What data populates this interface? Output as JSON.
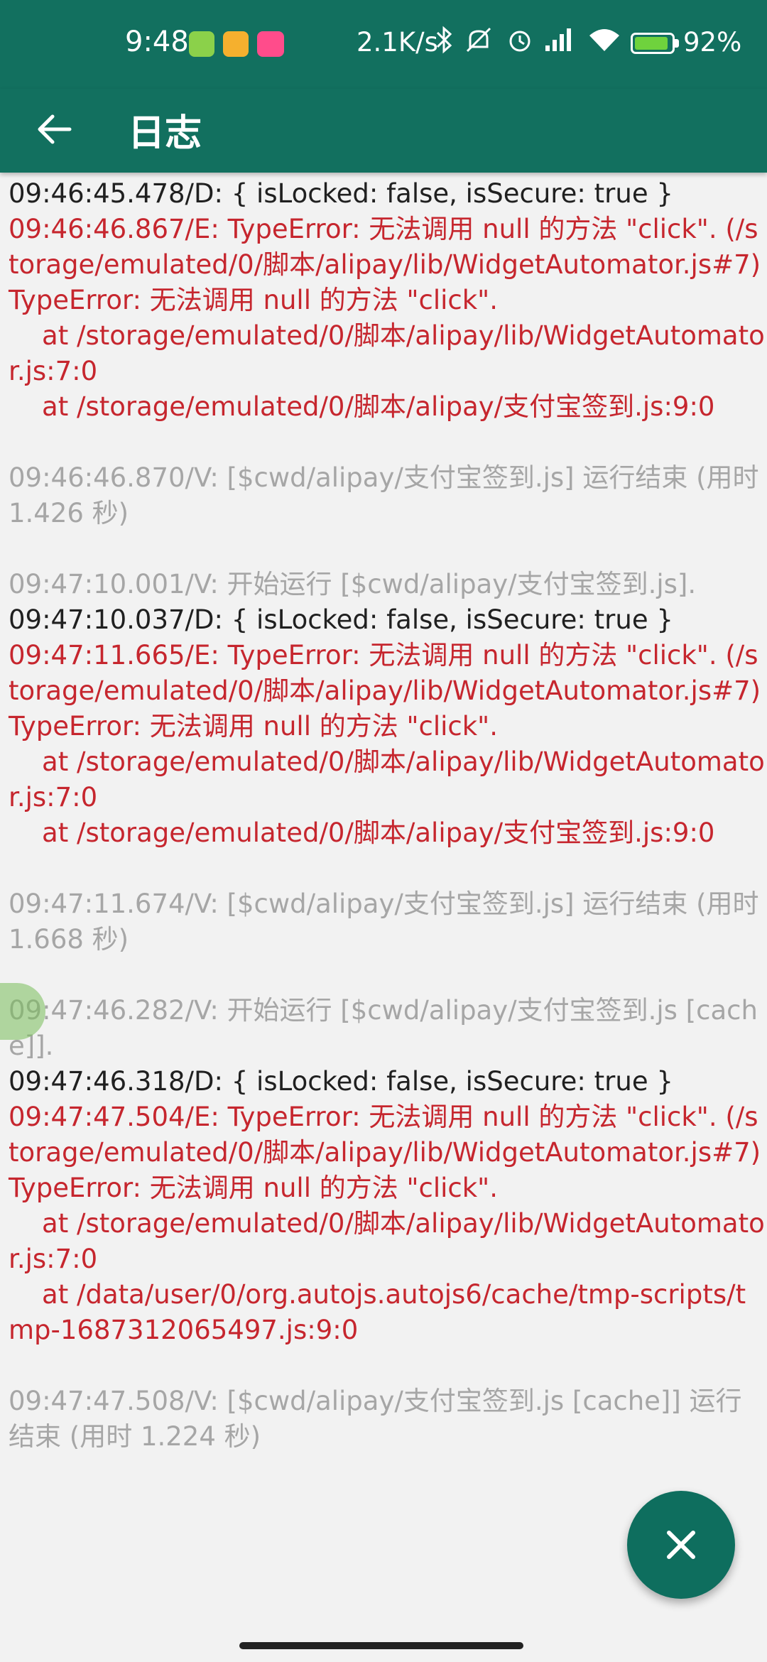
{
  "status_bar": {
    "time": "9:48",
    "net_speed": "2.1K/s",
    "battery_percent": 92,
    "battery_label": "92%",
    "notification_icons": [
      "wechat-icon",
      "memo-icon",
      "bilibili-icon"
    ],
    "notification_colors": [
      "#8bd14a",
      "#f5b02e",
      "#ff4c8b"
    ]
  },
  "app_bar": {
    "title": "日志"
  },
  "log": [
    {
      "level": "D",
      "text": "09:46:45.478/D: { isLocked: false, isSecure: true }"
    },
    {
      "level": "E",
      "text": "09:46:46.867/E: TypeError: 无法调用 null 的方法 \"click\". (/storage/emulated/0/脚本/alipay/lib/WidgetAutomator.js#7)\nTypeError: 无法调用 null 的方法 \"click\".\n    at /storage/emulated/0/脚本/alipay/lib/WidgetAutomator.js:7:0\n    at /storage/emulated/0/脚本/alipay/支付宝签到.js:9:0"
    },
    {
      "level": "V",
      "text": "09:46:46.870/V: [$cwd/alipay/支付宝签到.js] 运行结束 (用时 1.426 秒)"
    },
    {
      "level": "V",
      "text": "09:47:10.001/V: 开始运行 [$cwd/alipay/支付宝签到.js]."
    },
    {
      "level": "D",
      "text": "09:47:10.037/D: { isLocked: false, isSecure: true }"
    },
    {
      "level": "E",
      "text": "09:47:11.665/E: TypeError: 无法调用 null 的方法 \"click\". (/storage/emulated/0/脚本/alipay/lib/WidgetAutomator.js#7)\nTypeError: 无法调用 null 的方法 \"click\".\n    at /storage/emulated/0/脚本/alipay/lib/WidgetAutomator.js:7:0\n    at /storage/emulated/0/脚本/alipay/支付宝签到.js:9:0"
    },
    {
      "level": "V",
      "text": "09:47:11.674/V: [$cwd/alipay/支付宝签到.js] 运行结束 (用时 1.668 秒)"
    },
    {
      "level": "V",
      "text": "09:47:46.282/V: 开始运行 [$cwd/alipay/支付宝签到.js [cache]]."
    },
    {
      "level": "D",
      "text": "09:47:46.318/D: { isLocked: false, isSecure: true }"
    },
    {
      "level": "E",
      "text": "09:47:47.504/E: TypeError: 无法调用 null 的方法 \"click\". (/storage/emulated/0/脚本/alipay/lib/WidgetAutomator.js#7)\nTypeError: 无法调用 null 的方法 \"click\".\n    at /storage/emulated/0/脚本/alipay/lib/WidgetAutomator.js:7:0\n    at /data/user/0/org.autojs.autojs6/cache/tmp-scripts/tmp-1687312065497.js:9:0"
    },
    {
      "level": "V",
      "text": "09:47:47.508/V: [$cwd/alipay/支付宝签到.js [cache]] 运行结束 (用时 1.224 秒)"
    }
  ],
  "fab": {
    "icon": "close-icon"
  },
  "colors": {
    "primary": "#12705f",
    "log_debug": "#202020",
    "log_error": "#c6262e",
    "log_verbose": "#a6a6a6"
  }
}
